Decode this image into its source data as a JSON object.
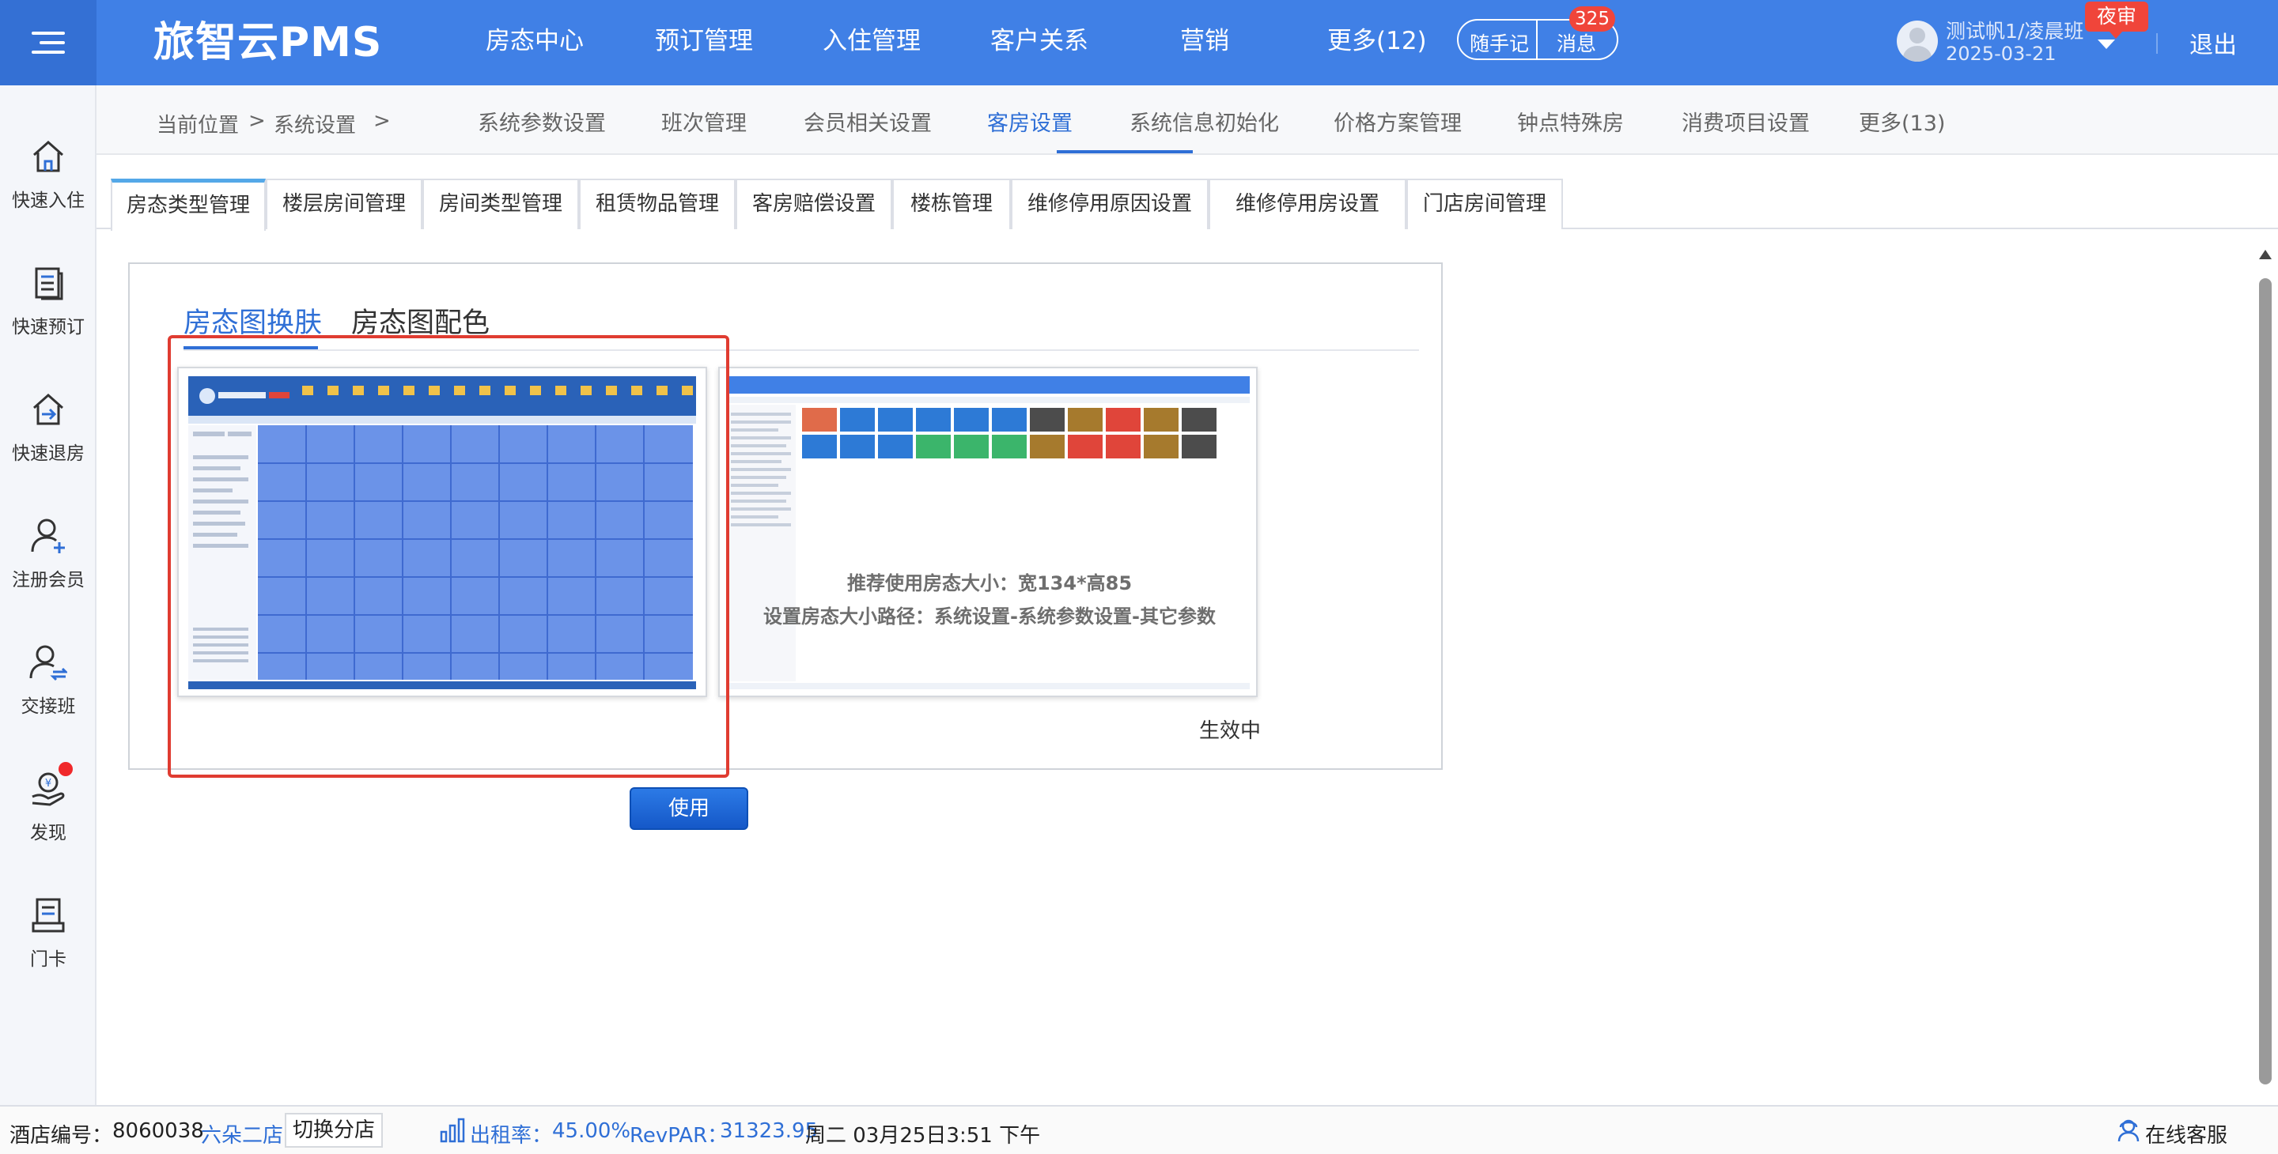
{
  "app": {
    "logo": "旅智云PMS"
  },
  "top_nav": [
    "房态中心",
    "预订管理",
    "入住管理",
    "客户关系",
    "营销",
    "更多(12)"
  ],
  "quick": {
    "memo_label": "随手记",
    "message_label": "消息",
    "message_count": "325"
  },
  "user": {
    "name": "测试帆1/凌晨班",
    "date": "2025-03-21",
    "night_audit_badge": "夜审",
    "logout_label": "退出"
  },
  "sidebar": [
    {
      "label": "快速入住",
      "icon": "home-icon"
    },
    {
      "label": "快速预订",
      "icon": "booking-icon"
    },
    {
      "label": "快速退房",
      "icon": "checkout-icon"
    },
    {
      "label": "注册会员",
      "icon": "user-add-icon"
    },
    {
      "label": "交接班",
      "icon": "shift-handover-icon"
    },
    {
      "label": "发现",
      "icon": "discover-icon"
    },
    {
      "label": "门卡",
      "icon": "room-card-icon"
    }
  ],
  "breadcrumb": {
    "prefix": "当前位置",
    "sep1": ">",
    "section": "系统设置",
    "sep2": ">"
  },
  "settings_nav": {
    "items": [
      "系统参数设置",
      "班次管理",
      "会员相关设置",
      "客房设置",
      "系统信息初始化",
      "价格方案管理",
      "钟点特殊房",
      "消费项目设置",
      "更多(13)"
    ],
    "active": "客房设置"
  },
  "tabs": {
    "items": [
      "房态类型管理",
      "楼层房间管理",
      "房间类型管理",
      "租赁物品管理",
      "客房赔偿设置",
      "楼栋管理",
      "维修停用原因设置",
      "维修停用房设置",
      "门店房间管理"
    ],
    "active": "房态类型管理"
  },
  "panel": {
    "subtabs": [
      "房态图换肤",
      "房态图配色"
    ],
    "active_subtab": "房态图换肤",
    "skin1": {
      "use_button": "使用"
    },
    "skin2": {
      "hint_line1": "推荐使用房态大小：宽134*高85",
      "hint_line2": "设置房态大小路径：系统设置-系统参数设置-其它参数",
      "status": "生效中"
    }
  },
  "status_bar": {
    "hotel_id_label": "酒店编号：",
    "hotel_id": "8060038",
    "store_name": "六朵二店",
    "switch_label": "切换分店",
    "occupancy_label": "出租率：",
    "occupancy": "45.00%",
    "revpar_label": "RevPAR：",
    "revpar": "31323.95",
    "datetime": "周二 03月25日3:51 下午",
    "support": "在线客服"
  },
  "colors": {
    "brand": "#4080e6",
    "accent": "#2f6fd6",
    "alert": "#f0453a"
  }
}
